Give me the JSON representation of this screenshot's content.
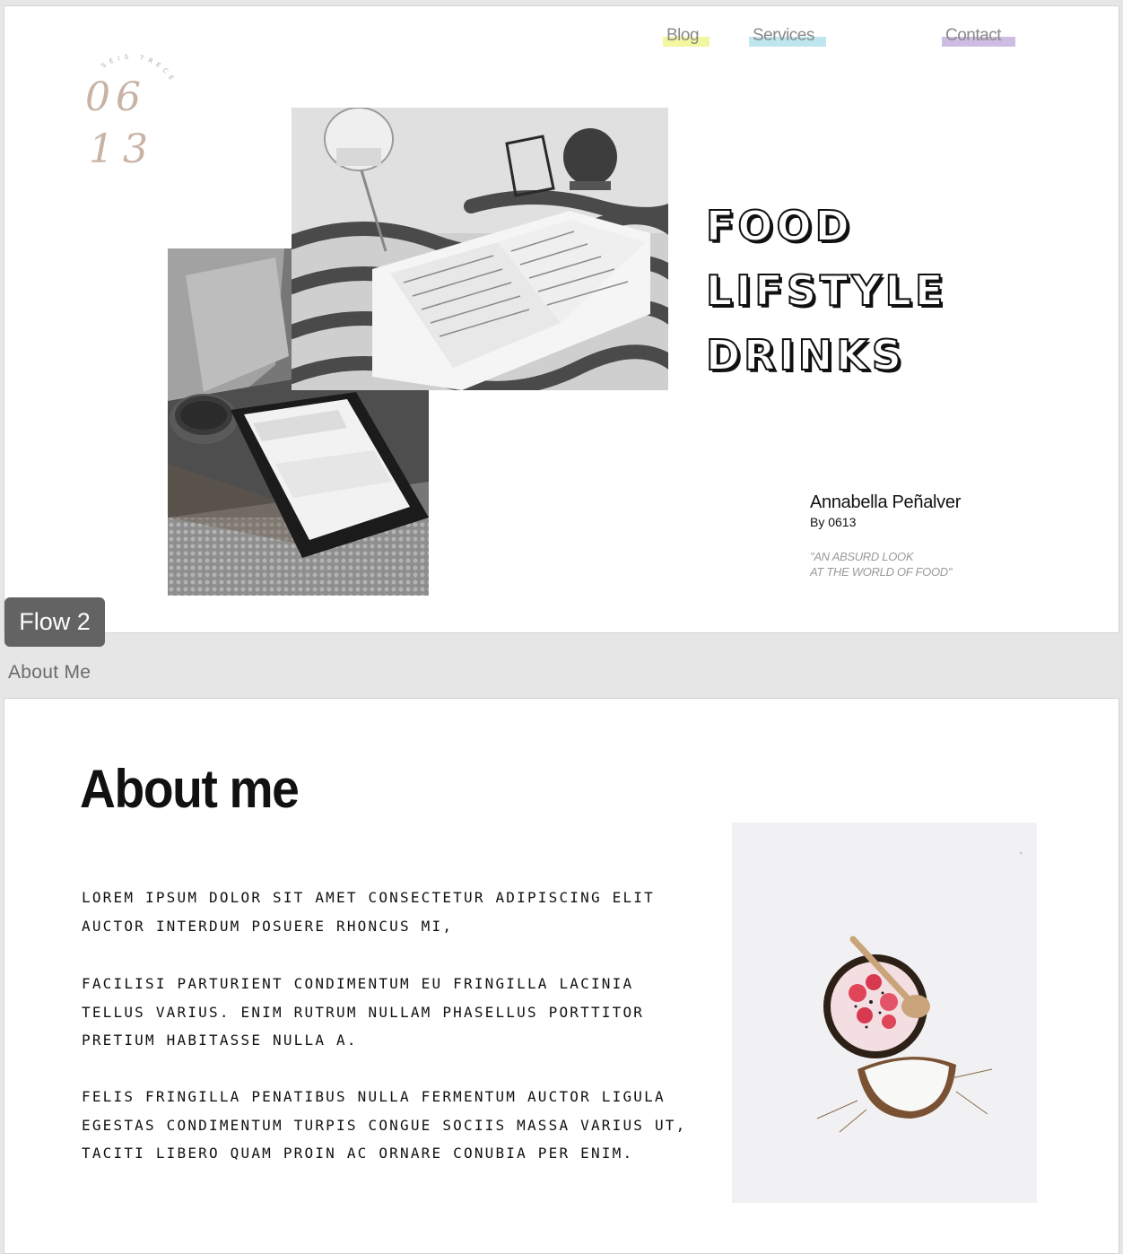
{
  "nav": {
    "blog": "Blog",
    "services": "Services",
    "contact": "Contact",
    "blog_color": "#f2f7a0",
    "services_color": "#bfe6ee",
    "contact_color": "#cdbde3"
  },
  "logo": {
    "ring_text": "SEIS TRECE",
    "line1": "06",
    "line2": "13",
    "color": "#c9b3a5"
  },
  "hero": {
    "line1": "FOOD",
    "line2": "LIFSTYLE",
    "line3": "DRINKS"
  },
  "author": {
    "name": "Annabella Peñalver",
    "by": "By 0613",
    "quote_line1": "\"AN ABSURD LOOK",
    "quote_line2": "AT THE WORLD OF FOOD\""
  },
  "canvas": {
    "flow_badge": "Flow 2",
    "frame_label": "About Me"
  },
  "about": {
    "title": "About me",
    "paragraphs": [
      "LOREM IPSUM DOLOR SIT AMET CONSECTETUR ADIPISCING ELIT AUCTOR INTERDUM POSUERE RHONCUS MI,",
      "FACILISI PARTURIENT CONDIMENTUM EU FRINGILLA LACINIA TELLUS VARIUS. ENIM RUTRUM NULLAM PHASELLUS PORTTITOR  PRETIUM HABITASSE NULLA A.",
      "FELIS FRINGILLA PENATIBUS NULLA FERMENTUM AUCTOR  LIGULA EGESTAS CONDIMENTUM TURPIS CONGUE SOCIIS MASSA VARIUS UT, TACITI LIBERO QUAM PROIN AC ORNARE CONUBIA PER ENIM."
    ]
  }
}
